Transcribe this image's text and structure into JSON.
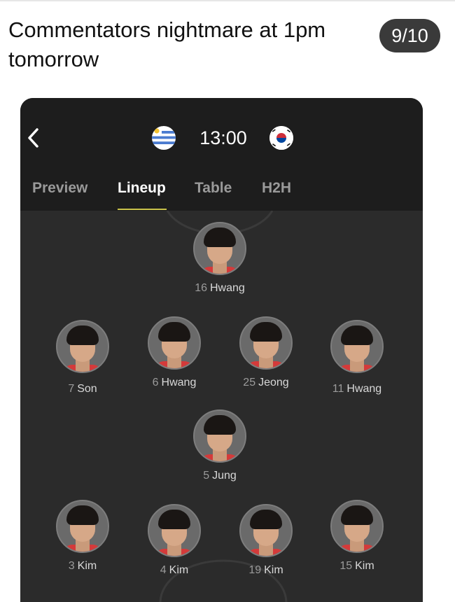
{
  "post": {
    "text": "Commentators nightmare at 1pm tomorrow",
    "counter": "9/10"
  },
  "match": {
    "time": "13:00",
    "home_flag": "uruguay-flag-icon",
    "away_flag": "south-korea-flag-icon"
  },
  "tabs": [
    {
      "label": "Preview",
      "active": false
    },
    {
      "label": "Lineup",
      "active": true
    },
    {
      "label": "Table",
      "active": false
    },
    {
      "label": "H2H",
      "active": false
    }
  ],
  "colors": {
    "header_bg": "#1d1d1d",
    "pitch_bg": "#2b2b2b",
    "tab_active": "#ffffff",
    "tab_inactive": "#9a9a9a",
    "tab_underline": "#c9c24a",
    "counter_bg": "#3a3a3a"
  },
  "players": [
    {
      "number": "16",
      "name": "Hwang"
    },
    {
      "number": "7",
      "name": "Son"
    },
    {
      "number": "6",
      "name": "Hwang"
    },
    {
      "number": "25",
      "name": "Jeong"
    },
    {
      "number": "11",
      "name": "Hwang"
    },
    {
      "number": "5",
      "name": "Jung"
    },
    {
      "number": "3",
      "name": "Kim"
    },
    {
      "number": "4",
      "name": "Kim"
    },
    {
      "number": "19",
      "name": "Kim"
    },
    {
      "number": "15",
      "name": "Kim"
    }
  ]
}
